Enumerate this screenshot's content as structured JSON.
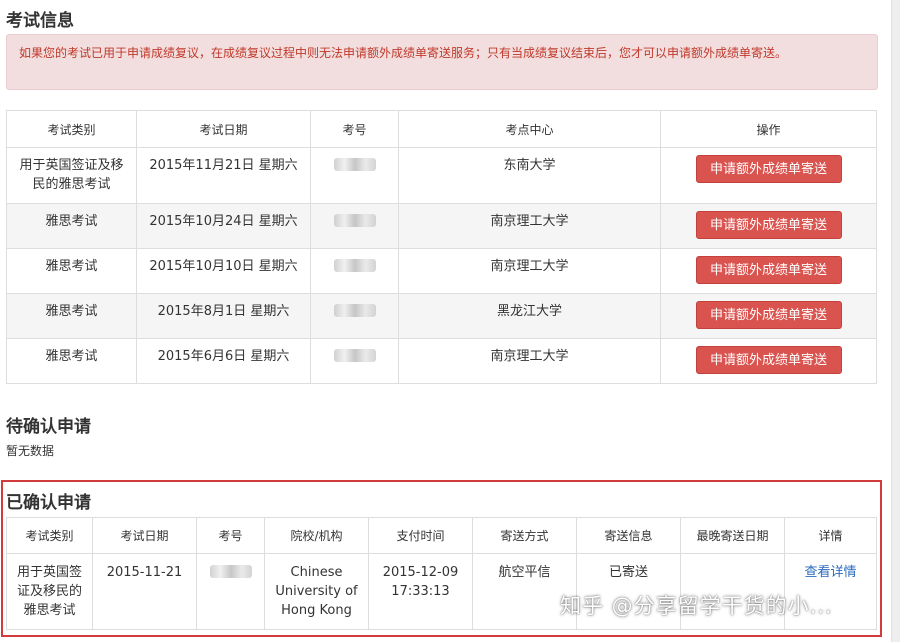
{
  "exam_info": {
    "title": "考试信息",
    "notice": "如果您的考试已用于申请成绩复议，在成绩复议过程中则无法申请额外成绩单寄送服务；只有当成绩复议结束后，您才可以申请额外成绩单寄送。",
    "headers": [
      "考试类别",
      "考试日期",
      "考号",
      "考点中心",
      "操作"
    ],
    "rows": [
      {
        "category": "用于英国签证及移民的雅思考试",
        "date": "2015年11月21日 星期六",
        "center": "东南大学",
        "action": "申请额外成绩单寄送"
      },
      {
        "category": "雅思考试",
        "date": "2015年10月24日 星期六",
        "center": "南京理工大学",
        "action": "申请额外成绩单寄送"
      },
      {
        "category": "雅思考试",
        "date": "2015年10月10日 星期六",
        "center": "南京理工大学",
        "action": "申请额外成绩单寄送"
      },
      {
        "category": "雅思考试",
        "date": "2015年8月1日 星期六",
        "center": "黑龙江大学",
        "action": "申请额外成绩单寄送"
      },
      {
        "category": "雅思考试",
        "date": "2015年6月6日 星期六",
        "center": "南京理工大学",
        "action": "申请额外成绩单寄送"
      }
    ]
  },
  "pending": {
    "title": "待确认申请",
    "empty_text": "暂无数据"
  },
  "confirmed": {
    "title": "已确认申请",
    "headers": [
      "考试类别",
      "考试日期",
      "考号",
      "院校/机构",
      "支付时间",
      "寄送方式",
      "寄送信息",
      "最晚寄送日期",
      "详情"
    ],
    "rows": [
      {
        "category": "用于英国签证及移民的雅思考试",
        "date": "2015-11-21",
        "institution": "Chinese University of Hong Kong",
        "pay_time": "2015-12-09 17:33:13",
        "method": "航空平信",
        "status": "已寄送",
        "deadline": "",
        "detail": "查看详情"
      }
    ]
  },
  "watermark": "知乎 @分享留学干货的小...",
  "colors": {
    "accent_red": "#d9534f",
    "alert_bg": "#f2dede",
    "alert_text": "#c0392b",
    "highlight_border": "#d23b3b",
    "link": "#2a6bbf"
  }
}
